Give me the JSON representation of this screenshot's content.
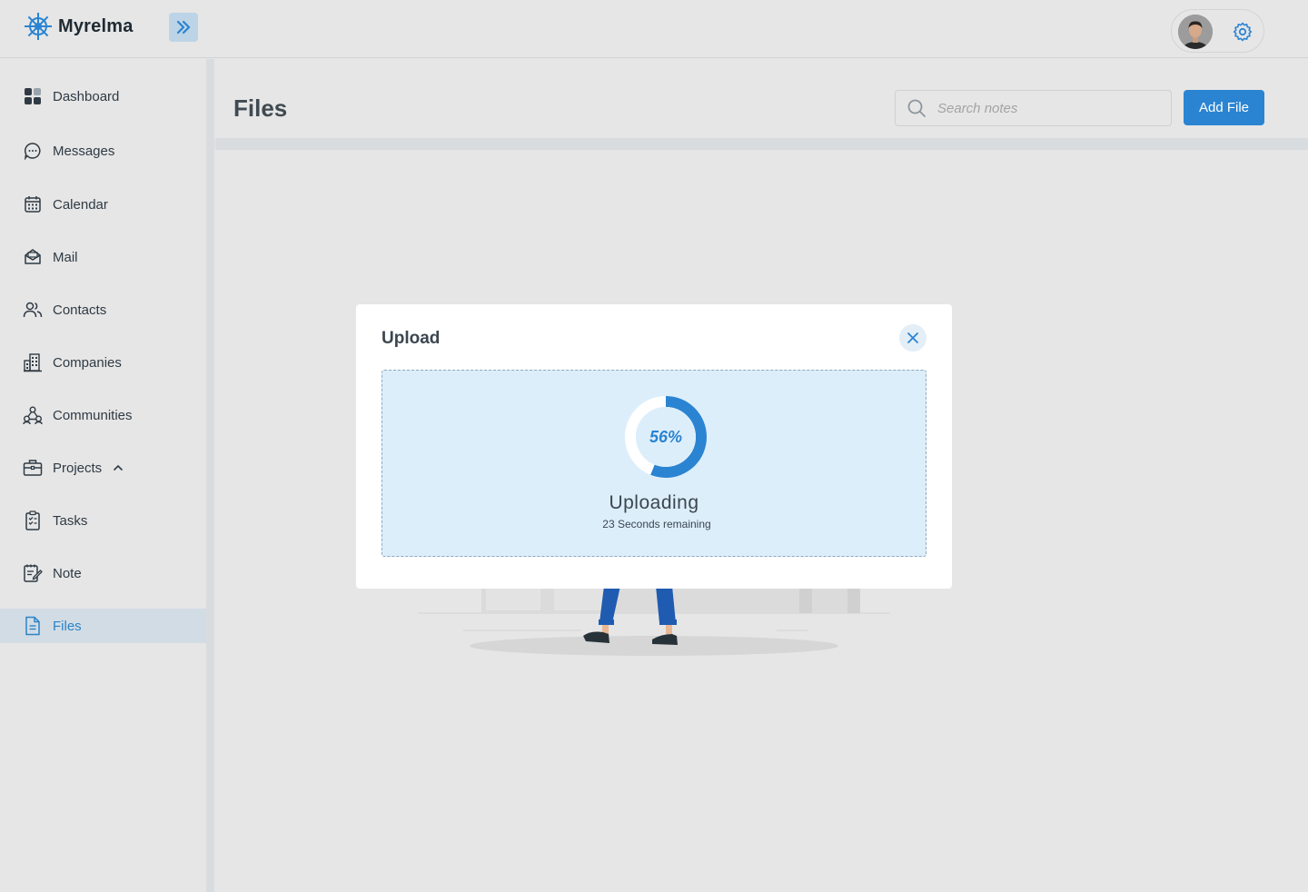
{
  "app": {
    "name": "Myrelma"
  },
  "sidebar": {
    "items": [
      {
        "label": "Dashboard",
        "icon": "dashboard-icon"
      },
      {
        "label": "Messages",
        "icon": "chat-icon"
      },
      {
        "label": "Calendar",
        "icon": "calendar-icon"
      },
      {
        "label": "Mail",
        "icon": "mail-icon"
      },
      {
        "label": "Contacts",
        "icon": "contacts-icon"
      },
      {
        "label": "Companies",
        "icon": "building-icon"
      },
      {
        "label": "Communities",
        "icon": "community-icon"
      },
      {
        "label": "Projects",
        "icon": "briefcase-icon",
        "expanded": true
      },
      {
        "label": "Tasks",
        "icon": "checklist-icon"
      },
      {
        "label": "Note",
        "icon": "note-icon"
      },
      {
        "label": "Files",
        "icon": "file-icon",
        "active": true
      }
    ]
  },
  "header": {
    "title": "Files",
    "search": {
      "placeholder": "Search notes",
      "value": ""
    },
    "add_button": "Add File"
  },
  "modal": {
    "title": "Upload",
    "progress_percent": 56,
    "progress_label": "56%",
    "status": "Uploading",
    "remaining": "23 Seconds remaining"
  },
  "colors": {
    "accent": "#2a84d2",
    "background": "#e6e6e6",
    "dropzone": "#ddeefb",
    "active_nav": "#d2dce5"
  }
}
